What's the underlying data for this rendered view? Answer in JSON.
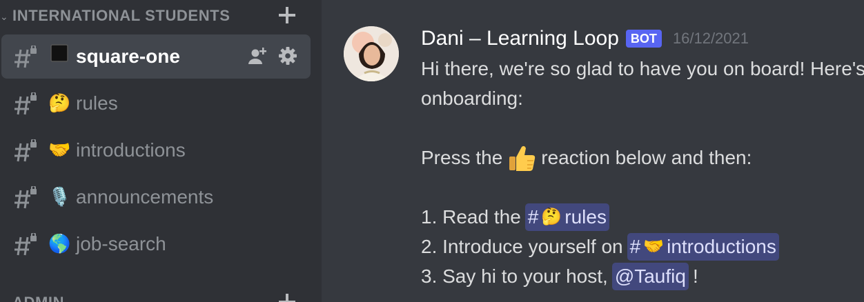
{
  "sidebar": {
    "category": "INTERNATIONAL STUDENTS",
    "channels": [
      {
        "emoji": "⬛",
        "name": "square-one"
      },
      {
        "emoji": "🤔",
        "name": "rules"
      },
      {
        "emoji": "🤝",
        "name": "introductions"
      },
      {
        "emoji": "🎙️",
        "name": "announcements"
      },
      {
        "emoji": "🌎",
        "name": "job-search"
      }
    ],
    "next_category": "ADMIN"
  },
  "message": {
    "author": "Dani – Learning Loop",
    "bot_tag": "BOT",
    "timestamp": "16/12/2021",
    "line1": "Hi there, we're so glad to have you on board! Here's your",
    "line2": "onboarding:",
    "press_before": "Press the",
    "press_after": "reaction below and then:",
    "step1_prefix": "1. Read the",
    "step1_channel_hash": "#",
    "step1_channel_emoji": "🤔",
    "step1_channel_name": "rules",
    "step2_prefix": "2. Introduce yourself on",
    "step2_channel_hash": "#",
    "step2_channel_emoji": "🤝",
    "step2_channel_name": "introductions",
    "step3_prefix": "3. Say hi to your host,",
    "step3_mention": "@Taufiq",
    "step3_suffix": "!"
  },
  "colors": {
    "sidebar_bg": "#2f3136",
    "chat_bg": "#36393f",
    "active_channel_bg": "#42464d",
    "bot_tag": "#5865f2",
    "mention_bg": "#4a4f8a"
  },
  "icons": {
    "hash_locked": "locked-hash-icon",
    "add": "plus-icon",
    "invite": "add-member-icon",
    "settings": "gear-icon",
    "reaction": "thumbs-up-icon"
  }
}
